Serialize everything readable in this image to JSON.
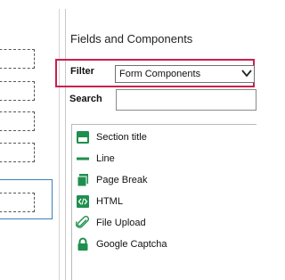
{
  "panel": {
    "title": "Fields and Components",
    "filter_label": "Filter",
    "filter_value": "Form Components",
    "search_label": "Search",
    "search_value": ""
  },
  "components": [
    {
      "label": "Section title",
      "icon": "section-title-icon"
    },
    {
      "label": "Line",
      "icon": "line-icon"
    },
    {
      "label": "Page Break",
      "icon": "page-break-icon"
    },
    {
      "label": "HTML",
      "icon": "html-icon"
    },
    {
      "label": "File Upload",
      "icon": "paperclip-icon"
    },
    {
      "label": "Google Captcha",
      "icon": "lock-icon"
    }
  ],
  "colors": {
    "accent_green": "#1f8f4e",
    "highlight_red": "#c8204f",
    "selection_blue": "#3d7fb8"
  }
}
